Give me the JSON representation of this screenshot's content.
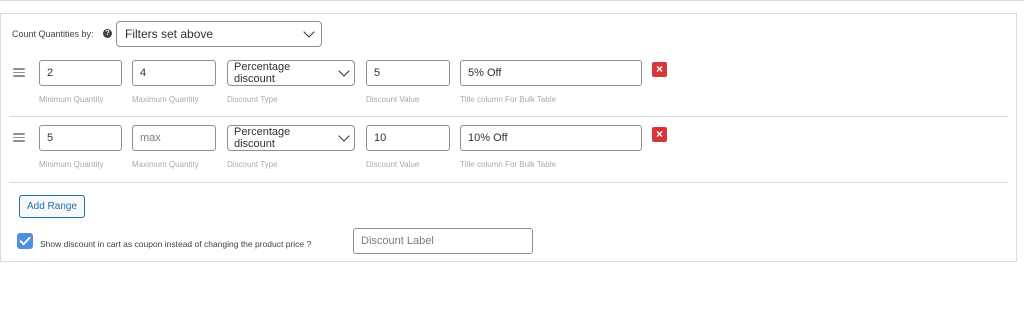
{
  "count": {
    "label": "Count Quantities by:",
    "help_icon": "question-circle-icon",
    "selected": "Filters set above"
  },
  "ranges": [
    {
      "min": "2",
      "max": "4",
      "max_is_placeholder": false,
      "discount_type": "Percentage discount",
      "discount_value": "5",
      "title": "5% Off"
    },
    {
      "min": "5",
      "max": "max",
      "max_is_placeholder": true,
      "discount_type": "Percentage discount",
      "discount_value": "10",
      "title": "10% Off"
    }
  ],
  "sublabels": {
    "min": "Minimum Quantity",
    "max": "Maximum Quantity",
    "type": "Discount Type",
    "value": "Discount Value",
    "title": "Title column For Bulk Table"
  },
  "add_range_label": "Add Range",
  "coupon": {
    "checked": true,
    "label": "Show discount in cart as coupon instead of changing the product price ?",
    "input_placeholder": "Discount Label"
  },
  "colors": {
    "delete": "#d63638",
    "checkbox": "#4f8fe0",
    "accent": "#2271b1"
  },
  "icons": {
    "drag": "drag-handle-icon",
    "delete": "close-icon",
    "check": "checkmark-icon"
  }
}
